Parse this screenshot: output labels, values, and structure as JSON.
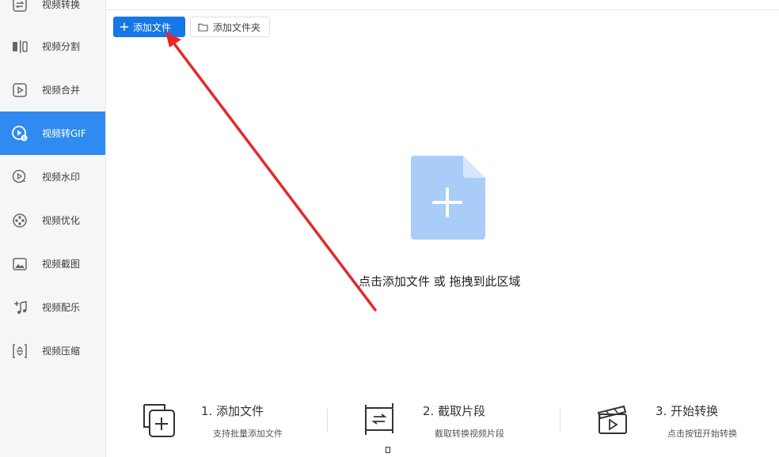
{
  "sidebar": {
    "items": [
      {
        "label": "视频转换",
        "icon": "convert-icon"
      },
      {
        "label": "视频分割",
        "icon": "split-icon"
      },
      {
        "label": "视频合并",
        "icon": "merge-icon"
      },
      {
        "label": "视频转GIF",
        "icon": "gif-icon",
        "active": true
      },
      {
        "label": "视频水印",
        "icon": "watermark-icon"
      },
      {
        "label": "视频优化",
        "icon": "film-reel-icon"
      },
      {
        "label": "视频截图",
        "icon": "screenshot-icon"
      },
      {
        "label": "视频配乐",
        "icon": "music-icon"
      },
      {
        "label": "视频压缩",
        "icon": "compress-icon"
      }
    ]
  },
  "toolbar": {
    "add_file_label": "添加文件",
    "add_folder_label": "添加文件夹"
  },
  "drop_zone": {
    "hint": "点击添加文件 或 拖拽到此区域"
  },
  "steps": [
    {
      "title": "1. 添加文件",
      "desc": "支持批量添加文件",
      "icon": "add-file-icon"
    },
    {
      "title": "2. 截取片段",
      "desc": "截取转换视频片段",
      "icon": "clip-icon"
    },
    {
      "title": "3. 开始转换",
      "desc": "点击按钮开始转换",
      "icon": "clapper-play-icon"
    }
  ],
  "colors": {
    "accent": "#2f8bf0",
    "primary_button": "#1677e8",
    "drop_icon": "#a9cdf8",
    "annotation_arrow": "#e8262a"
  }
}
